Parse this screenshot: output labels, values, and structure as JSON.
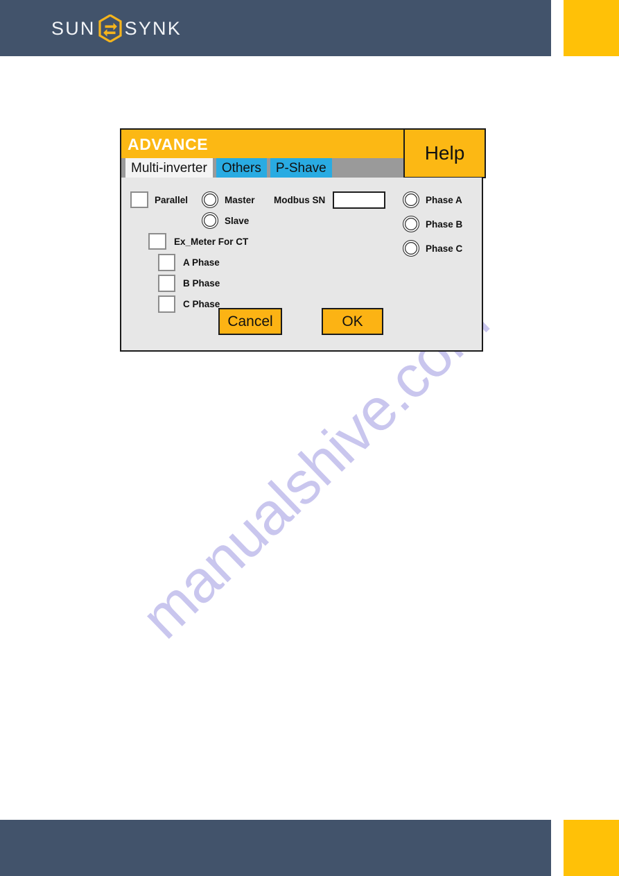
{
  "brand": {
    "name_left": "SUN",
    "name_right": "SYNK",
    "logo_icon": "sunsynk-hexagon-sync-icon",
    "bar_color": "#42536b",
    "accent_color": "#ffc107"
  },
  "watermark": {
    "text": "manualshive.com",
    "color": "#c9c6ee"
  },
  "dialog": {
    "title": "ADVANCE",
    "title_bar_color": "#fcb814",
    "help_label": "Help",
    "tabs": [
      {
        "label": "Multi-inverter",
        "active": true
      },
      {
        "label": "Others",
        "active": false
      },
      {
        "label": "P-Shave",
        "active": false
      }
    ],
    "tab_active_color": "#f4f4f4",
    "tab_inactive_color": "#29abe2",
    "tabstrip_color": "#9a9a9a",
    "fields": {
      "parallel_label": "Parallel",
      "parallel_checked": false,
      "master_label": "Master",
      "master_selected": false,
      "slave_label": "Slave",
      "slave_selected": false,
      "modbus_sn_label": "Modbus SN",
      "modbus_sn_value": "",
      "modbus_sn_placeholder": "",
      "ex_meter_label": "Ex_Meter For CT",
      "ex_meter_checked": false,
      "a_phase_label": "A Phase",
      "a_phase_checked": false,
      "b_phase_label": "B Phase",
      "b_phase_checked": false,
      "c_phase_label": "C Phase",
      "c_phase_checked": false,
      "phase_a_label": "Phase A",
      "phase_a_selected": false,
      "phase_b_label": "Phase B",
      "phase_b_selected": false,
      "phase_c_label": "Phase C",
      "phase_c_selected": false
    },
    "buttons": {
      "cancel_label": "Cancel",
      "ok_label": "OK",
      "color": "#fcb314"
    }
  }
}
